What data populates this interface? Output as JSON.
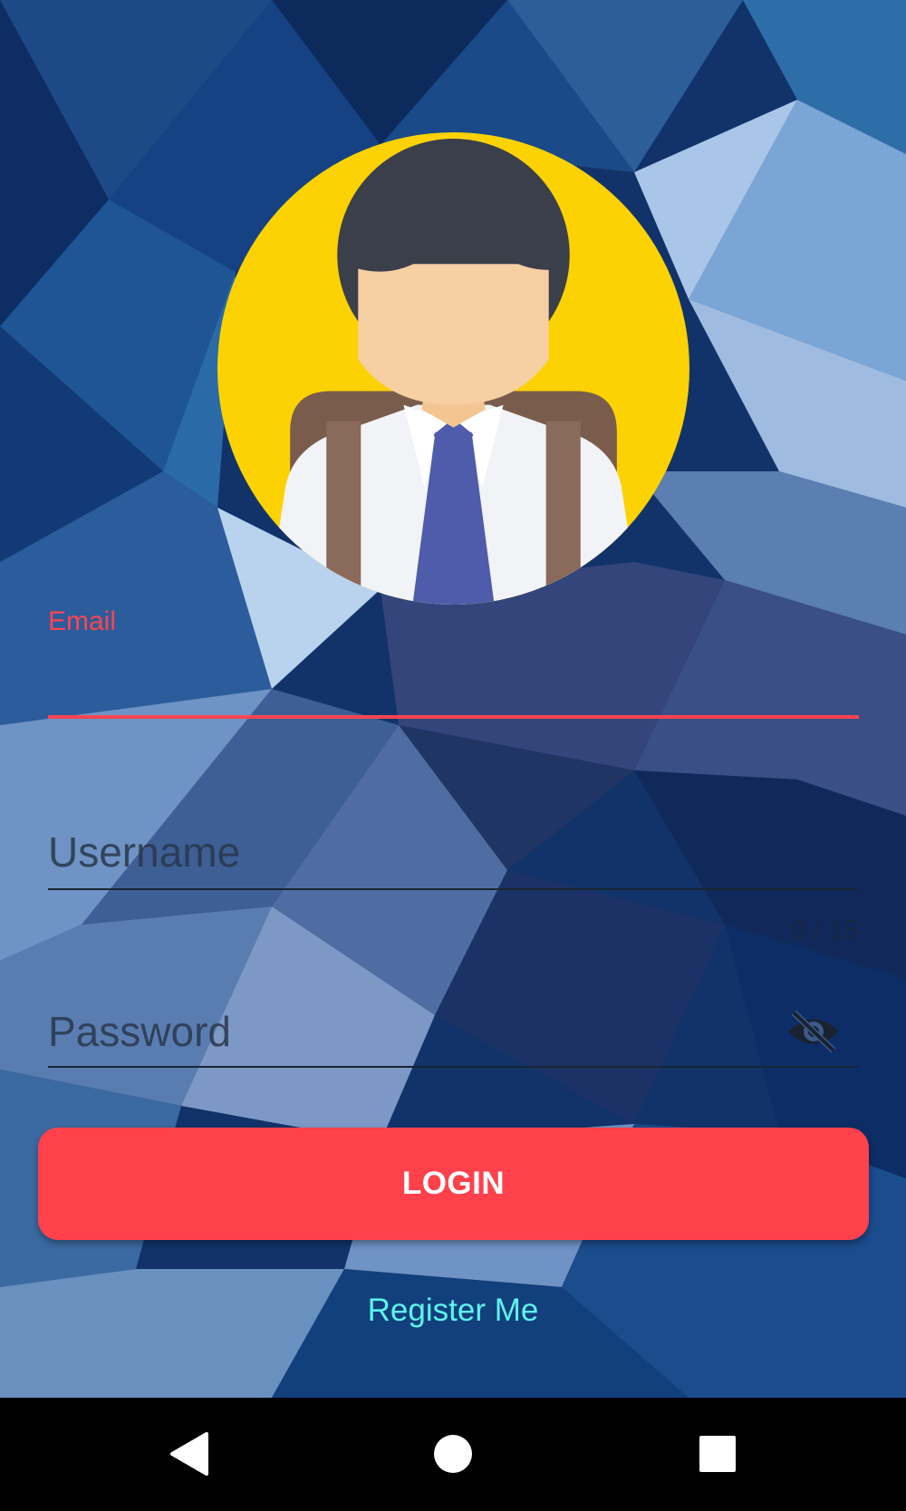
{
  "form": {
    "email_label": "Email",
    "email_value": "",
    "username_placeholder": "Username",
    "username_value": "",
    "username_counter": "0 / 15",
    "password_placeholder": "Password",
    "password_value": "",
    "password_toggle_icon": "eye-off-icon",
    "login_label": "LOGIN",
    "register_label": "Register Me"
  },
  "avatar": {
    "icon": "user-avatar-icon"
  },
  "nav": {
    "back_icon": "back-triangle-icon",
    "home_icon": "home-circle-icon",
    "recents_icon": "recents-square-icon"
  },
  "colors": {
    "accent": "#ff4451",
    "button": "#ff414c",
    "link": "#5ff2ee",
    "avatar_bg": "#fcd202",
    "background": "#0f2a55"
  }
}
